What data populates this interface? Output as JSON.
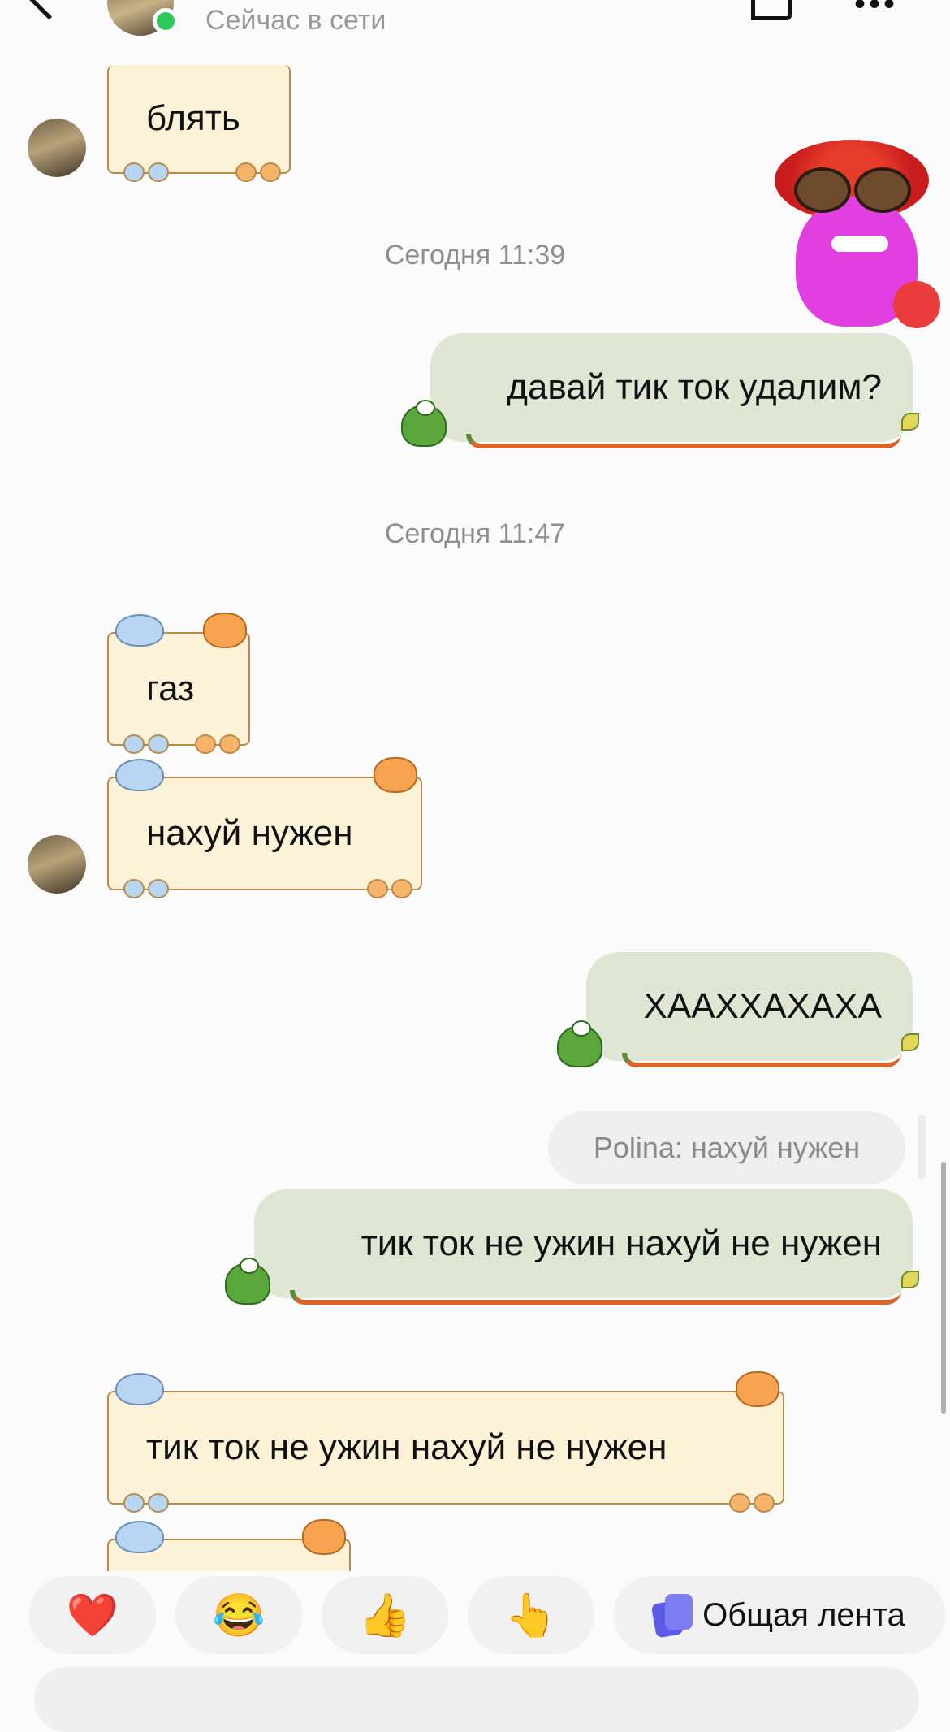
{
  "header": {
    "status": "Сейчас в сети"
  },
  "timestamps": [
    "Сегодня 11:39",
    "Сегодня 11:47"
  ],
  "messages": {
    "m1": "блять",
    "m2": "давай тик ток удалим?",
    "m3": "газ",
    "m4": "нахуй нужен",
    "m5": "ХААХХАХАХА",
    "reply_quote": "Polina: нахуй нужен",
    "m6": "тик ток не ужин нахуй не нужен",
    "m7": "тик ток не ужин нахуй не нужен"
  },
  "reactions": {
    "heart": "❤️",
    "laugh": "😂",
    "thumbs_up": "👍",
    "point": "👆",
    "feed_label": "Общая лента"
  },
  "colors": {
    "incoming_bg": "#fbf2d7",
    "outgoing_bg": "#dfe6d4",
    "online": "#2fc95b"
  }
}
